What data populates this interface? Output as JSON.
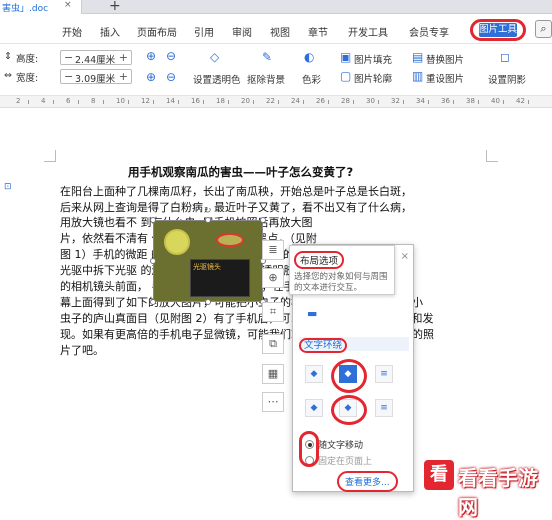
{
  "tabbar": {
    "doc_name": "害虫」.doc",
    "close": "×",
    "new_tab": "+"
  },
  "menu": {
    "items": [
      "开始",
      "插入",
      "页面布局",
      "引用",
      "审阅",
      "视图",
      "章节",
      "开发工具",
      "会员专享"
    ],
    "active": "图片工具",
    "search_icon": "search-icon"
  },
  "toolbar": {
    "height_label": "高度:",
    "height_value": "2.44厘米",
    "width_label": "宽度:",
    "width_value": "3.09厘米",
    "set_transparent": "设置透明色",
    "remove_bg": "抠除背景",
    "color": "色彩",
    "picture_fill": "图片填充",
    "picture_outline": "图片轮廓",
    "replace_picture": "替换图片",
    "reset_picture": "重设图片",
    "set_shadow": "设置阴影"
  },
  "ruler": {
    "numbers": [
      "2",
      "4",
      "6",
      "8",
      "10",
      "12",
      "14",
      "16",
      "18",
      "20",
      "22",
      "24",
      "26",
      "28",
      "30",
      "32",
      "34",
      "36",
      "38",
      "40",
      "42"
    ]
  },
  "document": {
    "heading": "用手机观察南瓜的害虫——叶子怎么变黄了?",
    "lines": [
      "在阳台上面种了几棵南瓜籽，长出了南瓜秧，开始总是叶子总是长白斑，",
      "后来从网上查询是得了白粉病，最近叶子又黄了，看不出又有了什么病，",
      "用放大镜也看不                   到有什么虫. 用手机拍照后再放大图",
      "片，依然看不清有                   什么?只是看到一些小黑点，（见附",
      "图 1）手机的微距                   的镜头，我就找出来了以前的一个报废的",
      "光驱中拆下光驱                     的激光头透镜，小心地用透明胶带固定到了手机",
      "的相机镜头前面，                   手机拍照后再放大图片，在手机的屏",
      "幕上面得到了如下的放大图片，可能把小虫子的模样看得更清楚，看到了小",
      "虫子的庐山真面目（见附图 2）有了手机后，可以帮助我们增长一些知识和发",
      "现。如果有更高倍的手机电子显微镜，可能我们就可以看到更加清晰害虫的照",
      "片了吧。"
    ]
  },
  "image": {
    "caption": "光驱镜头"
  },
  "layout_popup": {
    "tooltip_title": "布局选项",
    "tooltip_desc": "选择您的对象如何与周围的文本进行交互。",
    "close": "×",
    "wrap_section": "文字环绕",
    "radio1": "随文字移动",
    "radio2": "固定在页面上",
    "see_more": "查看更多..."
  },
  "watermark": {
    "logo": "看",
    "text": "看看手游网"
  }
}
